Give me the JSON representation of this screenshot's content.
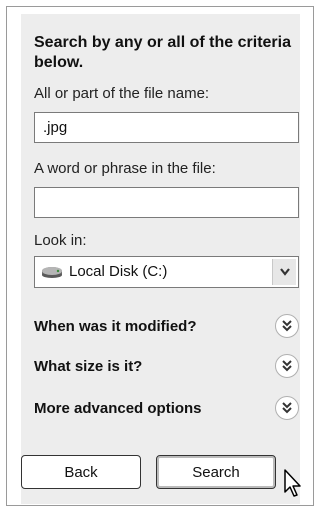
{
  "search_panel": {
    "heading": "Search by any or all of the criteria below.",
    "filename_label": "All or part of the file name:",
    "filename_value": ".jpg",
    "phrase_label": "A word or phrase in the file:",
    "phrase_value": "",
    "look_in_label": "Look in:",
    "look_in_value": "Local Disk (C:)",
    "look_in_icon": "hard-disk-icon",
    "options": [
      {
        "label": "When was it modified?"
      },
      {
        "label": "What size is it?"
      },
      {
        "label": "More advanced options"
      }
    ],
    "back_label": "Back",
    "search_label": "Search"
  }
}
